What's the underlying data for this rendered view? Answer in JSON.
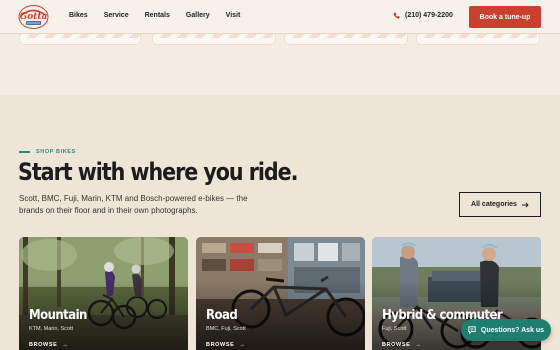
{
  "brand": {
    "logo_text": "Gotta Ride"
  },
  "nav": {
    "items": [
      "Bikes",
      "Service",
      "Rentals",
      "Gallery",
      "Visit"
    ]
  },
  "header": {
    "phone": "(210) 479-2200",
    "cta_label": "Book a tune-up"
  },
  "shop": {
    "eyebrow": "SHOP BIKES",
    "title": "Start with where you ride.",
    "subtitle": "Scott, BMC, Fuji, Marin, KTM and Bosch-powered e-bikes — the brands on their floor and in their own photographs.",
    "all_categories_label": "All categories"
  },
  "cards": [
    {
      "title": "Mountain",
      "brands": "KTM, Marin, Scott",
      "browse": "BROWSE"
    },
    {
      "title": "Road",
      "brands": "BMC, Fuji, Scott",
      "browse": "BROWSE"
    },
    {
      "title": "Hybrid & commuter",
      "brands": "Fuji, Scott",
      "browse": "BROWSE"
    }
  ],
  "chat": {
    "label": "Questions? Ask us"
  },
  "colors": {
    "accent": "#c9412e",
    "teal": "#2d8a7e",
    "background": "#efe5d7"
  },
  "icons": {
    "phone": "phone-icon",
    "arrow": "arrow-right-icon",
    "chat": "chat-icon"
  }
}
